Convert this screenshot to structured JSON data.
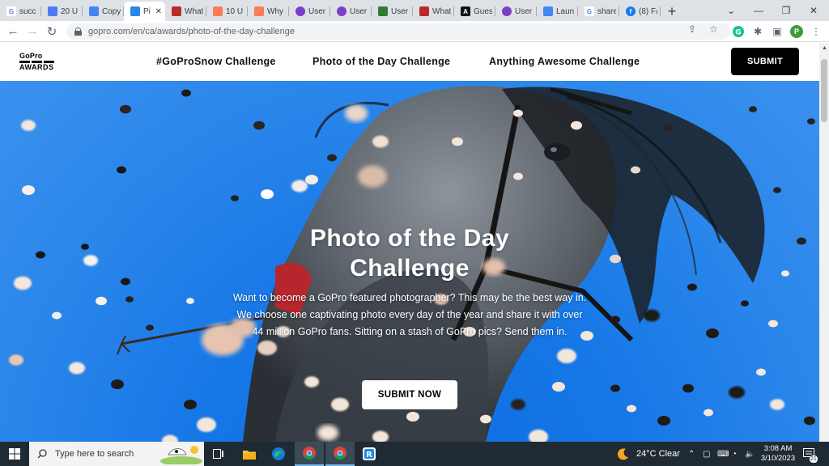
{
  "browser": {
    "tabs": [
      {
        "label": "succ",
        "icon": "google-icon",
        "color": "#4285f4"
      },
      {
        "label": "20 U",
        "icon": "diamond-icon",
        "color": "#4e7bf5"
      },
      {
        "label": "Copy",
        "icon": "docs-icon",
        "color": "#4285f4"
      },
      {
        "label": "Pi",
        "icon": "gopro-awards-icon",
        "color": "#2a86ea",
        "active": true
      },
      {
        "label": "What",
        "icon": "quora-icon",
        "color": "#b92b27"
      },
      {
        "label": "10 U",
        "icon": "hubspot-icon",
        "color": "#ff7a59"
      },
      {
        "label": "Why",
        "icon": "hubspot-icon",
        "color": "#ff7a59"
      },
      {
        "label": "User",
        "icon": "circle-icon",
        "color": "#7a3fc7"
      },
      {
        "label": "User",
        "icon": "circle-icon",
        "color": "#7a3fc7"
      },
      {
        "label": "User",
        "icon": "square-icon",
        "color": "#2e7d32"
      },
      {
        "label": "What",
        "icon": "quora-icon",
        "color": "#b92b27"
      },
      {
        "label": "Gues",
        "icon": "letter-a-icon",
        "color": "#111111"
      },
      {
        "label": "User",
        "icon": "circle-icon",
        "color": "#7a3fc7"
      },
      {
        "label": "Laun",
        "icon": "docs-icon",
        "color": "#4285f4"
      },
      {
        "label": "share",
        "icon": "google-icon",
        "color": "#4285f4"
      },
      {
        "label": "(8) Fa",
        "icon": "facebook-icon",
        "color": "#1877f2"
      }
    ],
    "new_tab": "+",
    "url": "gopro.com/en/ca/awards/photo-of-the-day-challenge",
    "profile_initial": "P"
  },
  "site": {
    "logo_top": "GoPro",
    "logo_bottom": "AWARDS",
    "nav": [
      "#GoProSnow Challenge",
      "Photo of the Day Challenge",
      "Anything Awesome Challenge"
    ],
    "submit_label": "SUBMIT"
  },
  "hero": {
    "title": "Photo of the Day Challenge",
    "description": "Want to become a GoPro featured photographer? This may be the best way in. We choose one captivating photo every day of the year and share it with over 44 million GoPro fans. Sitting on a stash of GoPro pics? Send them in.",
    "cta_label": "SUBMIT NOW"
  },
  "taskbar": {
    "search_placeholder": "Type here to search",
    "weather": "24°C  Clear",
    "time": "3:08 AM",
    "date": "3/10/2023",
    "notification_count": "21"
  }
}
